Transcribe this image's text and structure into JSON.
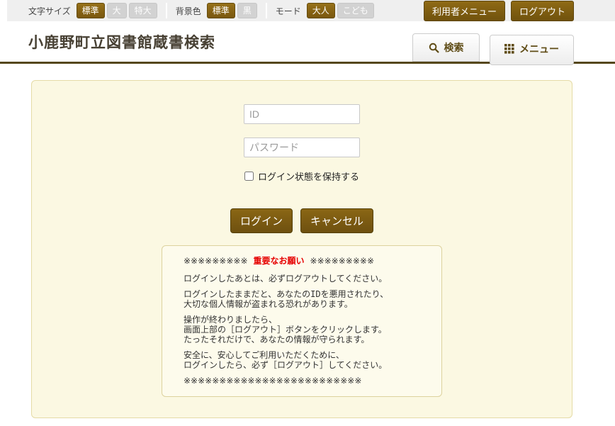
{
  "topbar": {
    "font_size": {
      "label": "文字サイズ",
      "options": [
        {
          "label": "標準",
          "active": true
        },
        {
          "label": "大",
          "active": false
        },
        {
          "label": "特大",
          "active": false
        }
      ]
    },
    "bg_color": {
      "label": "背景色",
      "options": [
        {
          "label": "標準",
          "active": true
        },
        {
          "label": "黒",
          "active": false
        }
      ]
    },
    "mode": {
      "label": "モード",
      "options": [
        {
          "label": "大人",
          "active": true
        },
        {
          "label": "こども",
          "active": false
        }
      ]
    },
    "user_menu_label": "利用者メニュー",
    "logout_label": "ログアウト"
  },
  "header": {
    "title": "小鹿野町立図書館蔵書検索",
    "tabs": {
      "search": {
        "label": "検索",
        "icon": "magnifier-icon"
      },
      "menu": {
        "label": "メニュー",
        "icon": "grid-3x3-icon"
      }
    }
  },
  "main": {
    "form": {
      "id_placeholder": "ID",
      "password_placeholder": "パスワード",
      "remember_label": "ログイン状態を保持する",
      "login_label": "ログイン",
      "cancel_label": "キャンセル"
    },
    "notice": {
      "stars_left": "※※※※※※※※※",
      "title": "重要なお願い",
      "stars_right": "※※※※※※※※※",
      "paragraphs": [
        {
          "lines": [
            "ログインしたあとは、必ずログアウトしてください。"
          ]
        },
        {
          "lines": [
            "ログインしたままだと、あなたのIDを悪用されたり、",
            "大切な個人情報が盗まれる恐れがあります。"
          ]
        },
        {
          "lines": [
            "操作が終わりましたら、",
            "画面上部の［ログアウト］ボタンをクリックします。",
            "たったそれだけで、あなたの情報が守られます。"
          ]
        },
        {
          "lines": [
            "安全に、安心してご利用いただくために、",
            "ログインしたら、必ず［ログアウト］してください。"
          ]
        }
      ],
      "footer_stars": "※※※※※※※※※※※※※※※※※※※※※※※※※"
    }
  },
  "colors": {
    "accent_brown": "#7a570e",
    "inactive_gray": "#d2d2d2",
    "header_rule": "#55471a",
    "panel_bg": "#fbf8e2",
    "panel_border": "#e5dba6",
    "notice_bg": "#fdfbec",
    "notice_red": "#e60000",
    "title_text": "#474033"
  }
}
